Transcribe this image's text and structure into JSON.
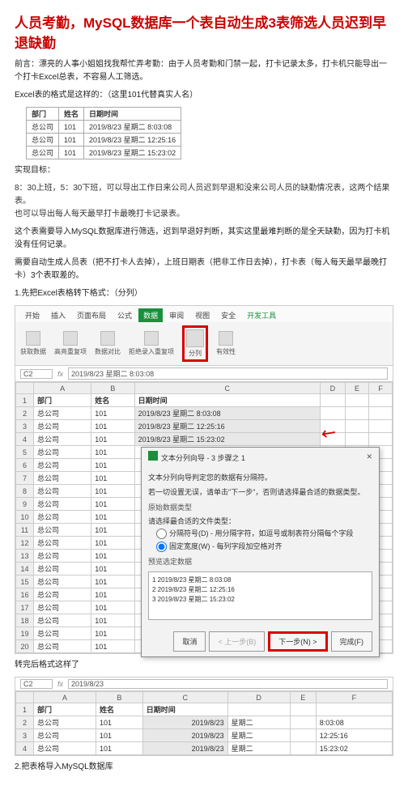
{
  "title": "人员考勤，MySQL数据库一个表自动生成3表筛选人员迟到早退缺勤",
  "preface": "前言：漂亮的人事小姐姐找我帮忙弄考勤：由于人员考勤和门禁一起，打卡记录太多，打卡机只能导出一个打卡Excel总表，不容易人工筛选。",
  "excel_format_note": "Excel表的格式是这样的：（这里101代替真实人名）",
  "small_table": {
    "headers": [
      "部门",
      "姓名",
      "日期时间"
    ],
    "rows": [
      [
        "总公司",
        "101",
        "2019/8/23 星期二 8:03:08"
      ],
      [
        "总公司",
        "101",
        "2019/8/23 星期二 12:25:16"
      ],
      [
        "总公司",
        "101",
        "2019/8/23 星期二 15:23:02"
      ]
    ]
  },
  "goal_title": "实现目标：",
  "goals": [
    "8：30上班，5：30下班，可以导出工作日来公司人员迟到早退和没来公司人员的缺勤情况表，这两个结果表。",
    "也可以导出每人每天最早打卡最晚打卡记录表。"
  ],
  "notes": [
    "这个表需要导入MySQL数据库进行筛选，迟到早退好判断，其实这里最难判断的是全天缺勤，因为打卡机没有任何记录。",
    "需要自动生成人员表（把不打卡人去掉），上班日期表（把非工作日去掉），打卡表（每人每天最早最晚打卡）3个表取差的。"
  ],
  "step1": "1.先把Excel表格转下格式：（分列）",
  "ribbon": {
    "tabs": [
      "开始",
      "插入",
      "页面布局",
      "公式",
      "数据",
      "审阅",
      "视图",
      "安全",
      "开发工具"
    ],
    "active": "数据",
    "groups": [
      "获取数据",
      "高亮重复项",
      "数据对比",
      "拒绝录入重复项",
      "分列",
      "有效性"
    ],
    "highlight": "分列"
  },
  "fx": {
    "cell": "C2",
    "formula": "2019/8/23 星期二 8:03:08"
  },
  "sheet1": {
    "cols": [
      "",
      "A",
      "B",
      "C",
      "D",
      "E",
      "F"
    ],
    "header_row": [
      "1",
      "部门",
      "姓名",
      "日期时间",
      "",
      "",
      ""
    ],
    "rows": [
      [
        "2",
        "总公司",
        "101",
        "2019/8/23 星期二 8:03:08",
        "",
        "",
        ""
      ],
      [
        "3",
        "总公司",
        "101",
        "2019/8/23 星期二 12:25:16",
        "",
        "",
        ""
      ],
      [
        "4",
        "总公司",
        "101",
        "2019/8/23 星期二 15:23:02",
        "",
        "",
        ""
      ],
      [
        "5",
        "总公司",
        "101",
        "",
        "",
        "",
        ""
      ],
      [
        "6",
        "总公司",
        "101",
        "",
        "",
        "",
        ""
      ],
      [
        "7",
        "总公司",
        "101",
        "",
        "",
        "",
        ""
      ],
      [
        "8",
        "总公司",
        "101",
        "",
        "",
        "",
        ""
      ],
      [
        "9",
        "总公司",
        "101",
        "",
        "",
        "",
        ""
      ],
      [
        "10",
        "总公司",
        "101",
        "",
        "",
        "",
        ""
      ],
      [
        "11",
        "总公司",
        "101",
        "",
        "",
        "",
        ""
      ],
      [
        "12",
        "总公司",
        "101",
        "",
        "",
        "",
        ""
      ],
      [
        "13",
        "总公司",
        "101",
        "",
        "",
        "",
        ""
      ],
      [
        "14",
        "总公司",
        "101",
        "",
        "",
        "",
        ""
      ],
      [
        "15",
        "总公司",
        "101",
        "",
        "",
        "",
        ""
      ],
      [
        "16",
        "总公司",
        "101",
        "",
        "",
        "",
        ""
      ],
      [
        "17",
        "总公司",
        "101",
        "",
        "",
        "",
        ""
      ],
      [
        "18",
        "总公司",
        "101",
        "",
        "",
        "",
        ""
      ],
      [
        "19",
        "总公司",
        "101",
        "",
        "",
        "",
        ""
      ],
      [
        "20",
        "总公司",
        "101",
        "",
        "",
        "",
        ""
      ]
    ]
  },
  "wizard": {
    "title": "文本分列向导 - 3 步骤之 1",
    "desc1": "文本分列向导判定您的数据有分隔符。",
    "desc2": "若一切设置无误，请单击\"下一步\"，否则请选择最合适的数据类型。",
    "sec1_title": "原始数据类型",
    "sec1_sub": "请选择最合适的文件类型：",
    "opt_delim": "分隔符号(D) - 用分隔字符，如逗号或制表符分隔每个字段",
    "opt_fixed": "固定宽度(W) - 每列字段加空格对齐",
    "sec2_title": "预览选定数据",
    "preview_rows": [
      "1 2019/8/23 星期二 8:03:08",
      "2 2019/8/23 星期二 12:25:16",
      "3 2019/8/23 星期二 15:23:02"
    ],
    "btns": {
      "cancel": "取消",
      "prev": "< 上一步(B)",
      "next": "下一步(N) >",
      "finish": "完成(F)"
    }
  },
  "after_note": "转完后格式这样了",
  "fx2": {
    "cell": "C2",
    "formula": "2019/8/23"
  },
  "sheet2": {
    "cols": [
      "",
      "A",
      "B",
      "C",
      "D",
      "E",
      "F"
    ],
    "header_row": [
      "1",
      "部门",
      "姓名",
      "日期时间",
      "",
      "",
      ""
    ],
    "rows": [
      [
        "2",
        "总公司",
        "101",
        "2019/8/23",
        "星期二",
        "",
        "8:03:08"
      ],
      [
        "3",
        "总公司",
        "101",
        "2019/8/23",
        "星期二",
        "",
        "12:25:16"
      ],
      [
        "4",
        "总公司",
        "101",
        "2019/8/23",
        "星期二",
        "",
        "15:23:02"
      ]
    ]
  },
  "step2": "2.把表格导入MySQL数据库"
}
